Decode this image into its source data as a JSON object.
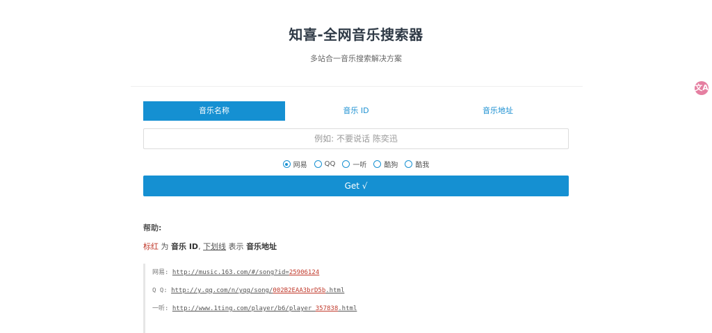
{
  "header": {
    "title": "知喜-全网音乐搜索器",
    "subtitle": "多站合一音乐搜索解决方案"
  },
  "float_badge": {
    "icon": "translate-icon",
    "glyph": "文A"
  },
  "tabs": [
    {
      "label": "音乐名称",
      "active": true
    },
    {
      "label": "音乐 ID",
      "active": false
    },
    {
      "label": "音乐地址",
      "active": false
    }
  ],
  "search": {
    "placeholder": "例如: 不要说话 陈奕迅",
    "value": ""
  },
  "sources": [
    {
      "label": "网易",
      "checked": true
    },
    {
      "label": "QQ",
      "checked": false
    },
    {
      "label": "一听",
      "checked": false
    },
    {
      "label": "酷狗",
      "checked": false
    },
    {
      "label": "酷我",
      "checked": false
    }
  ],
  "submit": {
    "label": "Get √"
  },
  "help": {
    "title": "帮助:",
    "legend": {
      "red_word": "标红",
      "text1": " 为 ",
      "bold1": "音乐 ID",
      "text2": ", ",
      "underline_word": "下划线",
      "text3": " 表示 ",
      "bold2": "音乐地址"
    },
    "examples": [
      {
        "label": "网易: ",
        "url_prefix": "http://music.163.com/#/song?id=",
        "id": "25906124",
        "url_suffix": ""
      },
      {
        "label": "Q Q: ",
        "url_prefix": "http://y.qq.com/n/yqq/song/",
        "id": "002B2EAA3brD5b",
        "url_suffix": ".html"
      },
      {
        "label": "一听: ",
        "url_prefix": "http://www.1ting.com/player/b6/player_",
        "id": "357838",
        "url_suffix": ".html"
      }
    ]
  },
  "colors": {
    "accent": "#1590d2",
    "highlight_red": "#c0392b",
    "badge_pink": "#e57fa1"
  }
}
